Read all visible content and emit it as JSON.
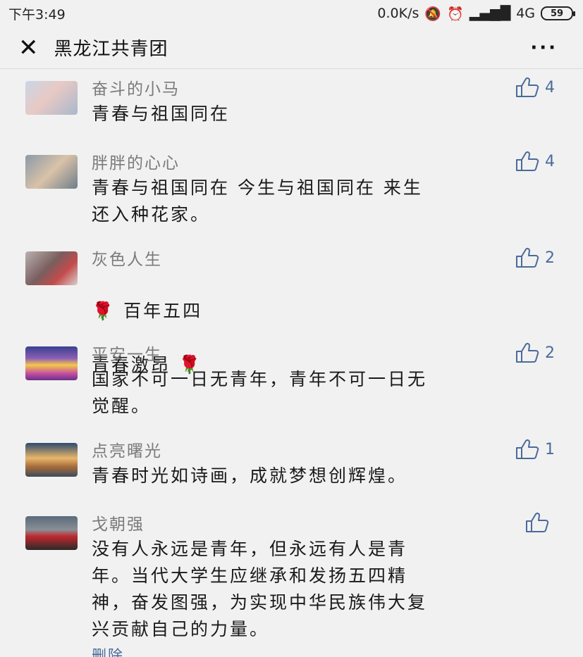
{
  "status_bar": {
    "time": "下午3:49",
    "network_speed": "0.0K/s",
    "signal": "4G",
    "battery": "59",
    "text_color": "#222222"
  },
  "nav": {
    "title": "黑龙江共青团",
    "more": "···"
  },
  "colors": {
    "background": "#f1f1f1",
    "nickname": "#7b7b7b",
    "link": "#4a6b9a"
  },
  "comments": [
    {
      "name": "奋斗的小马",
      "text": "青春与祖国同在",
      "likes": "4",
      "avatar_icon": "avatar-child-photo"
    },
    {
      "name": "胖胖的心心",
      "text": "青春与祖国同在 今生与祖国同在 来生\n还入种花家。",
      "likes": "4",
      "avatar_icon": "avatar-baby-photo"
    },
    {
      "name": "灰色人生",
      "text_line1": "百年五四",
      "text_line2": "青春激昂",
      "likes": "2",
      "avatar_icon": "avatar-anime-girl"
    },
    {
      "name": "平安一生",
      "text": "国家不可一日无青年，青年不可一日无\n觉醒。",
      "likes": "2",
      "avatar_icon": "avatar-sunset"
    },
    {
      "name": "点亮曙光",
      "text": "青春时光如诗画，成就梦想创辉煌。",
      "likes": "1",
      "avatar_icon": "avatar-coast-sunrise"
    },
    {
      "name": "戈朝强",
      "text": "没有人永远是青年，但永远有人是青\n年。当代大学生应继承和发扬五四精\n神，奋发图强，为实现中华民族伟大复\n兴贡献自己的力量。",
      "likes": "",
      "delete_label": "删除",
      "avatar_icon": "avatar-red-jeep"
    }
  ]
}
